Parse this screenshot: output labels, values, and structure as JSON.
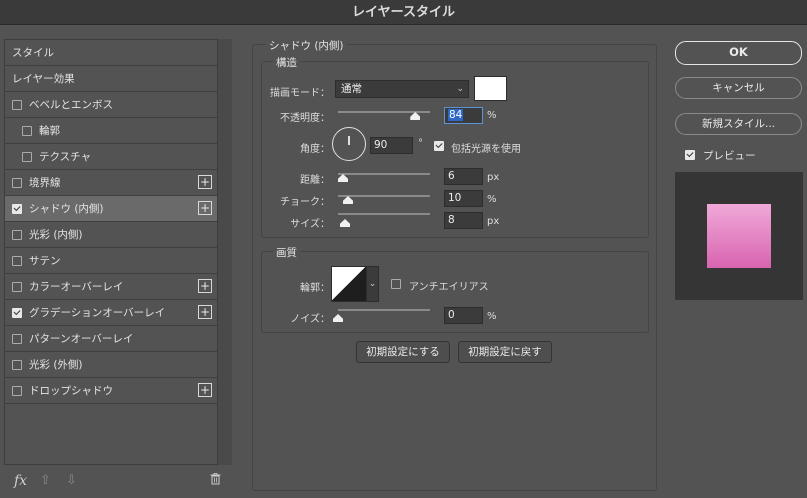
{
  "window": {
    "title": "レイヤースタイル"
  },
  "style_list": {
    "header": "スタイル",
    "items": [
      {
        "label": "レイヤー効果",
        "checkbox": false,
        "checked": false,
        "plus": false,
        "selected": false,
        "indent": 0
      },
      {
        "label": "ベベルとエンボス",
        "checkbox": true,
        "checked": false,
        "plus": false,
        "selected": false,
        "indent": 0
      },
      {
        "label": "輪郭",
        "checkbox": true,
        "checked": false,
        "plus": false,
        "selected": false,
        "indent": 1
      },
      {
        "label": "テクスチャ",
        "checkbox": true,
        "checked": false,
        "plus": false,
        "selected": false,
        "indent": 1
      },
      {
        "label": "境界線",
        "checkbox": true,
        "checked": false,
        "plus": true,
        "selected": false,
        "indent": 0
      },
      {
        "label": "シャドウ (内側)",
        "checkbox": true,
        "checked": true,
        "plus": true,
        "selected": true,
        "indent": 0
      },
      {
        "label": "光彩 (内側)",
        "checkbox": true,
        "checked": false,
        "plus": false,
        "selected": false,
        "indent": 0
      },
      {
        "label": "サテン",
        "checkbox": true,
        "checked": false,
        "plus": false,
        "selected": false,
        "indent": 0
      },
      {
        "label": "カラーオーバーレイ",
        "checkbox": true,
        "checked": false,
        "plus": true,
        "selected": false,
        "indent": 0
      },
      {
        "label": "グラデーションオーバーレイ",
        "checkbox": true,
        "checked": true,
        "plus": true,
        "selected": false,
        "indent": 0
      },
      {
        "label": "パターンオーバーレイ",
        "checkbox": true,
        "checked": false,
        "plus": false,
        "selected": false,
        "indent": 0
      },
      {
        "label": "光彩 (外側)",
        "checkbox": true,
        "checked": false,
        "plus": false,
        "selected": false,
        "indent": 0
      },
      {
        "label": "ドロップシャドウ",
        "checkbox": true,
        "checked": false,
        "plus": true,
        "selected": false,
        "indent": 0
      }
    ],
    "bottom_icons": {
      "fx": "fx",
      "up": "⇧",
      "down": "⇩",
      "trash": "🗑"
    }
  },
  "panel": {
    "title": "シャドウ (内側)",
    "structure": {
      "legend": "構造",
      "blend_mode_label": "描画モード：",
      "blend_mode_value": "通常",
      "opacity_label": "不透明度：",
      "opacity_value": "84",
      "opacity_fraction": 0.84,
      "opacity_unit": "%",
      "angle_label": "角度：",
      "angle_value": "90",
      "angle_unit": "°",
      "global_light_label": "包括光源を使用",
      "global_light_checked": true,
      "distance_label": "距離：",
      "distance_value": "6",
      "distance_unit": "px",
      "choke_label": "チョーク：",
      "choke_value": "10",
      "choke_unit": "%",
      "size_label": "サイズ：",
      "size_value": "8",
      "size_unit": "px",
      "shadow_color": "#ffffff"
    },
    "quality": {
      "legend": "画質",
      "contour_label": "輪郭：",
      "anti_alias_label": "アンチエイリアス",
      "anti_alias_checked": false,
      "noise_label": "ノイズ：",
      "noise_value": "0",
      "noise_unit": "%"
    },
    "buttons": {
      "make_default": "初期設定にする",
      "reset_default": "初期設定に戻す"
    }
  },
  "actions": {
    "ok": "OK",
    "cancel": "キャンセル",
    "new_style": "新規スタイル...",
    "preview_label": "プレビュー",
    "preview_checked": true
  },
  "colors": {
    "background": "#535353",
    "accent": "#2f67c7",
    "preview_gradient_top": "#f0a9d8",
    "preview_gradient_bottom": "#d864b0"
  }
}
